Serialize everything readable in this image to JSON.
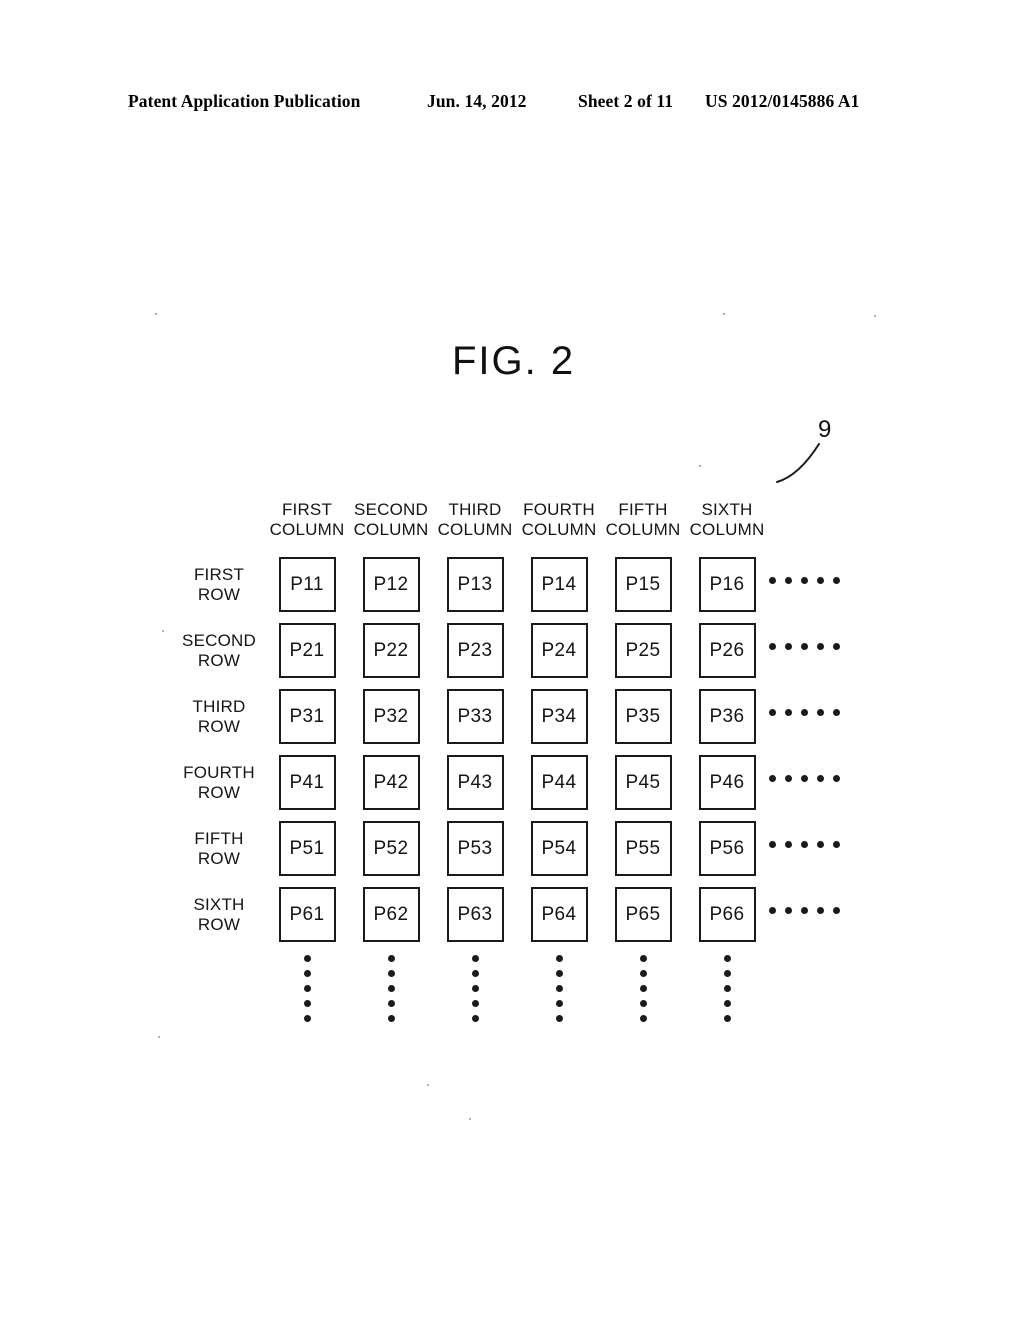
{
  "header": {
    "publication": "Patent Application Publication",
    "date": "Jun. 14, 2012",
    "sheet": "Sheet 2 of 11",
    "patent_number": "US 2012/0145886 A1"
  },
  "figure": {
    "title": "FIG. 2",
    "reference_numeral": "9",
    "column_headers": [
      {
        "line1": "FIRST",
        "line2": "COLUMN"
      },
      {
        "line1": "SECOND",
        "line2": "COLUMN"
      },
      {
        "line1": "THIRD",
        "line2": "COLUMN"
      },
      {
        "line1": "FOURTH",
        "line2": "COLUMN"
      },
      {
        "line1": "FIFTH",
        "line2": "COLUMN"
      },
      {
        "line1": "SIXTH",
        "line2": "COLUMN"
      }
    ],
    "row_headers": [
      {
        "line1": "FIRST",
        "line2": "ROW"
      },
      {
        "line1": "SECOND",
        "line2": "ROW"
      },
      {
        "line1": "THIRD",
        "line2": "ROW"
      },
      {
        "line1": "FOURTH",
        "line2": "ROW"
      },
      {
        "line1": "FIFTH",
        "line2": "ROW"
      },
      {
        "line1": "SIXTH",
        "line2": "ROW"
      }
    ],
    "cells": [
      [
        "P11",
        "P12",
        "P13",
        "P14",
        "P15",
        "P16"
      ],
      [
        "P21",
        "P22",
        "P23",
        "P24",
        "P25",
        "P26"
      ],
      [
        "P31",
        "P32",
        "P33",
        "P34",
        "P35",
        "P36"
      ],
      [
        "P41",
        "P42",
        "P43",
        "P44",
        "P45",
        "P46"
      ],
      [
        "P51",
        "P52",
        "P53",
        "P54",
        "P55",
        "P56"
      ],
      [
        "P61",
        "P62",
        "P63",
        "P64",
        "P65",
        "P66"
      ]
    ],
    "row_ellipsis_dot_count": 5,
    "column_ellipsis_dot_count": 5,
    "colors": {
      "ink": "#1a1a1a",
      "paper": "#ffffff"
    }
  }
}
